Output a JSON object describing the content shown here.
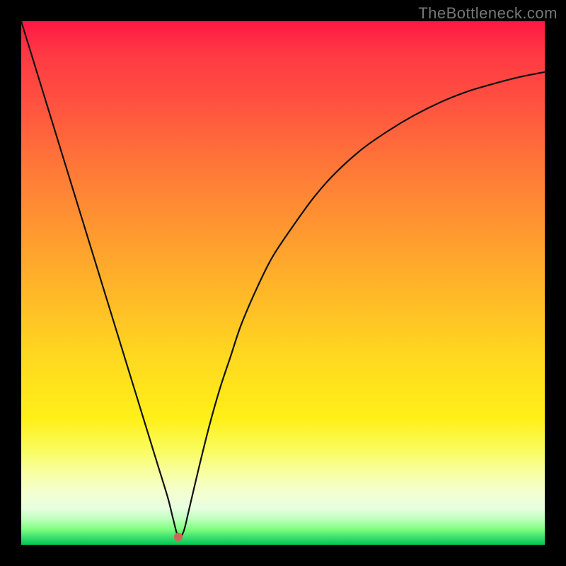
{
  "watermark": "TheBottleneck.com",
  "chart_data": {
    "type": "line",
    "title": "",
    "xlabel": "",
    "ylabel": "",
    "xlim": [
      0,
      100
    ],
    "ylim": [
      0,
      100
    ],
    "grid": false,
    "series": [
      {
        "name": "bottleneck-curve",
        "x": [
          0,
          2,
          4,
          6,
          8,
          10,
          12,
          14,
          16,
          18,
          20,
          22,
          24,
          26,
          28,
          29,
          30,
          31,
          32,
          34,
          36,
          38,
          40,
          42,
          45,
          48,
          52,
          56,
          60,
          65,
          70,
          75,
          80,
          85,
          90,
          95,
          100
        ],
        "y": [
          100,
          93.5,
          87,
          80.5,
          74,
          67.5,
          61,
          54.5,
          48,
          41.5,
          35,
          28.5,
          22,
          15.5,
          9,
          5,
          1.5,
          2.5,
          6.5,
          15,
          23,
          30,
          36,
          42,
          49,
          55,
          61,
          66.5,
          71,
          75.5,
          79,
          82,
          84.5,
          86.5,
          88,
          89.3,
          90.3
        ]
      }
    ],
    "annotations": [
      {
        "name": "min-dot",
        "x": 30,
        "y": 1.5
      }
    ],
    "background_gradient": {
      "type": "vertical",
      "stops": [
        {
          "pos": 0.0,
          "color": "#ff1744"
        },
        {
          "pos": 0.5,
          "color": "#ffb828"
        },
        {
          "pos": 0.8,
          "color": "#fafc60"
        },
        {
          "pos": 1.0,
          "color": "#00c853"
        }
      ]
    }
  }
}
